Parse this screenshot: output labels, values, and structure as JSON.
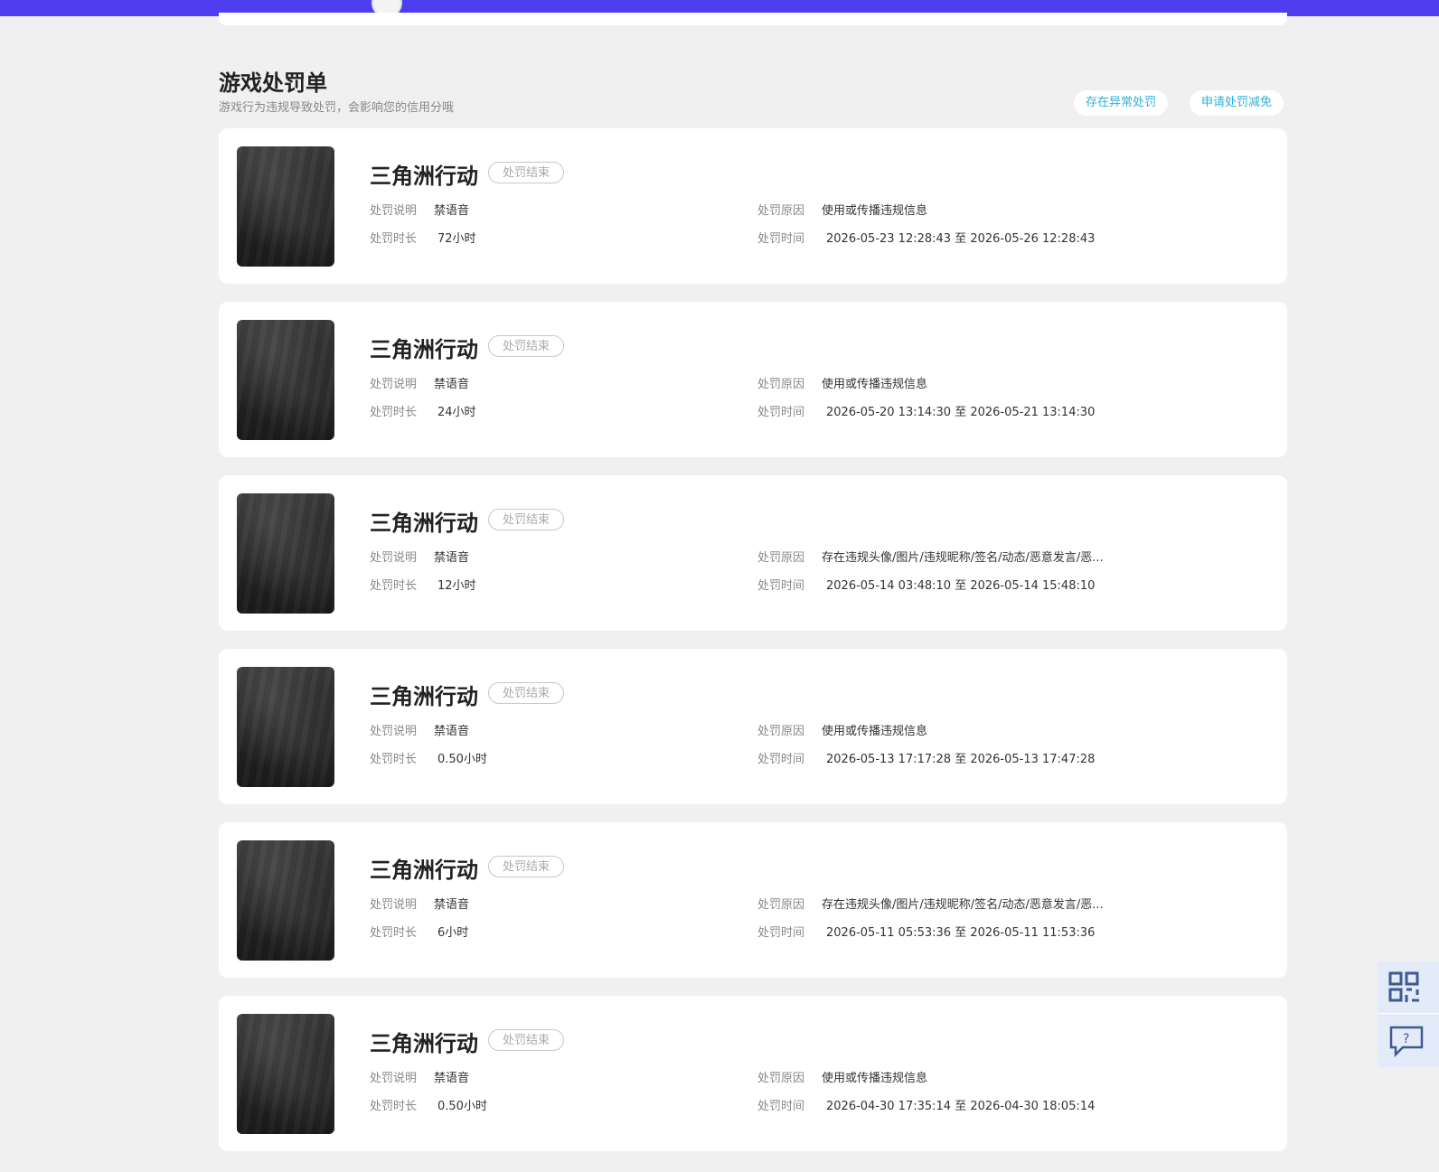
{
  "header": {
    "nav_fragment_1": "",
    "nav_fragment_2": ""
  },
  "page": {
    "title": "游戏处罚单",
    "subtitle": "游戏行为违规导致处罚，会影响您的信用分哦",
    "btn_abnormal": "存在异常处罚",
    "btn_reduce": "申请处罚减免"
  },
  "labels": {
    "desc": "处罚说明",
    "duration": "处罚时长",
    "reason": "处罚原因",
    "time": "处罚时间"
  },
  "records": [
    {
      "game": "三角洲行动",
      "status": "处罚结束",
      "desc": "禁语音",
      "duration": "72小时",
      "reason": "使用或传播违规信息",
      "time": "2026-05-23 12:28:43 至 2026-05-26 12:28:43"
    },
    {
      "game": "三角洲行动",
      "status": "处罚结束",
      "desc": "禁语音",
      "duration": "24小时",
      "reason": "使用或传播违规信息",
      "time": "2026-05-20 13:14:30 至 2026-05-21 13:14:30"
    },
    {
      "game": "三角洲行动",
      "status": "处罚结束",
      "desc": "禁语音",
      "duration": "12小时",
      "reason": "存在违规头像/图片/违规昵称/签名/动态/恶意发言/恶...",
      "time": "2026-05-14 03:48:10 至 2026-05-14 15:48:10"
    },
    {
      "game": "三角洲行动",
      "status": "处罚结束",
      "desc": "禁语音",
      "duration": "0.50小时",
      "reason": "使用或传播违规信息",
      "time": "2026-05-13 17:17:28 至 2026-05-13 17:47:28"
    },
    {
      "game": "三角洲行动",
      "status": "处罚结束",
      "desc": "禁语音",
      "duration": "6小时",
      "reason": "存在违规头像/图片/违规昵称/签名/动态/恶意发言/恶...",
      "time": "2026-05-11 05:53:36 至 2026-05-11 11:53:36"
    },
    {
      "game": "三角洲行动",
      "status": "处罚结束",
      "desc": "禁语音",
      "duration": "0.50小时",
      "reason": "使用或传播违规信息",
      "time": "2026-04-30 17:35:14 至 2026-04-30 18:05:14"
    }
  ],
  "side_tools": [
    "qr-code-icon",
    "help-chat-icon"
  ],
  "colors": {
    "topbar": "#4f3df0",
    "accent": "#2fb0d8",
    "background": "#f0f0f0"
  }
}
